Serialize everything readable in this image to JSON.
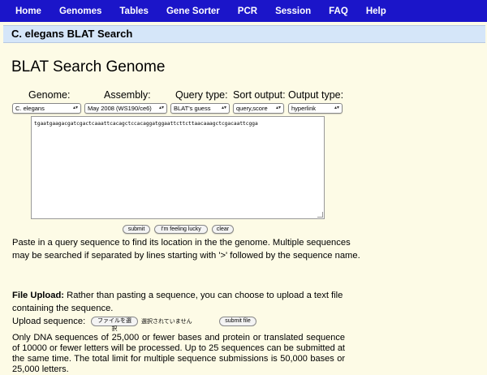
{
  "nav": {
    "items": [
      "Home",
      "Genomes",
      "Tables",
      "Gene Sorter",
      "PCR",
      "Session",
      "FAQ",
      "Help"
    ]
  },
  "section": {
    "title": "C. elegans BLAT Search"
  },
  "page": {
    "title": "BLAT Search Genome"
  },
  "form": {
    "labels": {
      "genome": "Genome:",
      "assembly": "Assembly:",
      "query_type": "Query type:",
      "sort_output": "Sort output:",
      "output_type": "Output type:"
    },
    "values": {
      "genome": "C. elegans",
      "assembly": "May 2008 (WS190/ce6)",
      "query_type": "BLAT's guess",
      "sort_output": "query,score",
      "output_type": "hyperlink"
    },
    "sequence": "tgaatgaagacgatcgactcaaattcacagctccacaggatggaattcttcttaacaaagctcgacaattcgga",
    "buttons": {
      "submit": "submit",
      "lucky": "I'm feeling lucky",
      "clear": "clear"
    }
  },
  "help_text": "Paste in a query sequence to find its location in the the genome. Multiple sequences may be searched if separated by lines starting with '>' followed by the sequence name.",
  "upload": {
    "heading": "File Upload:",
    "description": " Rather than pasting a sequence, you can choose to upload a text file containing the sequence.",
    "label": "Upload sequence:",
    "choose_button": "ファイルを選択",
    "no_file_text": "選択されていません",
    "submit_button": "submit file"
  },
  "limits_note": "Only DNA sequences of 25,000 or fewer bases and protein or translated sequence of 10000 or fewer letters will be processed. Up to 25 sequences can be submitted at the same time. The total limit for multiple sequence submissions is 50,000 bases or 25,000 letters."
}
